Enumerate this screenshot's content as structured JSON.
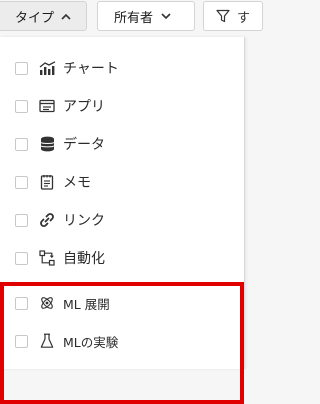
{
  "toolbar": {
    "type_label": "タイプ",
    "owner_label": "所有者",
    "filter_label": "す"
  },
  "menu": {
    "items": [
      {
        "label": "チャート",
        "icon": "chart-icon"
      },
      {
        "label": "アプリ",
        "icon": "app-icon"
      },
      {
        "label": "データ",
        "icon": "database-icon"
      },
      {
        "label": "メモ",
        "icon": "memo-icon"
      },
      {
        "label": "リンク",
        "icon": "link-icon"
      },
      {
        "label": "自動化",
        "icon": "automation-icon"
      },
      {
        "label": "ML 展開",
        "icon": "ml-deployment-icon"
      },
      {
        "label": "MLの実験",
        "icon": "flask-icon"
      }
    ]
  },
  "colors": {
    "highlight": "#e00000",
    "checkbox_border": "#c8c8c8",
    "text": "#2b2b2b"
  }
}
